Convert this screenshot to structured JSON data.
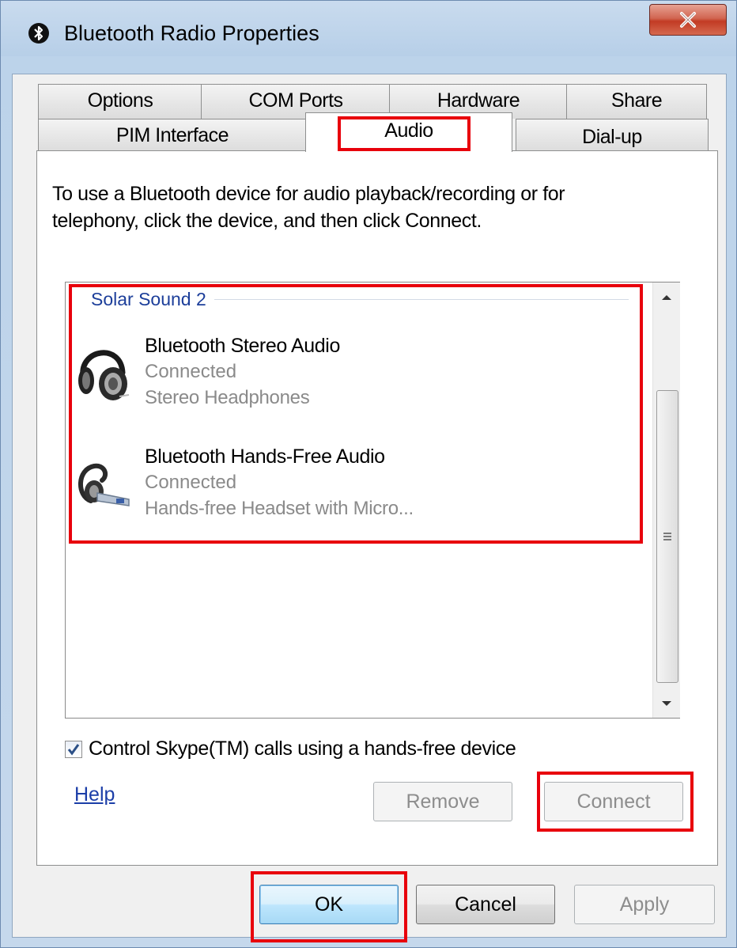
{
  "window": {
    "title": "Bluetooth Radio Properties",
    "close_label": "X"
  },
  "tabs": {
    "row1": [
      {
        "label": "Options"
      },
      {
        "label": "COM Ports"
      },
      {
        "label": "Hardware"
      },
      {
        "label": "Share"
      }
    ],
    "row2": [
      {
        "label": "PIM Interface"
      },
      {
        "label": "Audio",
        "active": true
      },
      {
        "label": "Dial-up"
      }
    ]
  },
  "panel": {
    "instructions": "To use a Bluetooth device for audio playback/recording or for telephony, click the device, and then click Connect.",
    "group_name": "Solar Sound 2",
    "devices": [
      {
        "name": "Bluetooth Stereo Audio",
        "status": "Connected",
        "type": "Stereo Headphones",
        "icon": "headphones-icon"
      },
      {
        "name": "Bluetooth Hands-Free Audio",
        "status": "Connected",
        "type": "Hands-free Headset with Micro...",
        "icon": "headset-icon"
      }
    ],
    "skype_checkbox_label": "Control Skype(TM) calls using a hands-free device",
    "skype_checked": true,
    "help_label": "Help",
    "remove_label": "Remove",
    "connect_label": "Connect"
  },
  "footer": {
    "ok_label": "OK",
    "cancel_label": "Cancel",
    "apply_label": "Apply"
  },
  "colors": {
    "highlight": "#e8000c",
    "group_header": "#1c3e9a",
    "link": "#1c3ea8",
    "disabled_text": "#8d8d8d"
  }
}
